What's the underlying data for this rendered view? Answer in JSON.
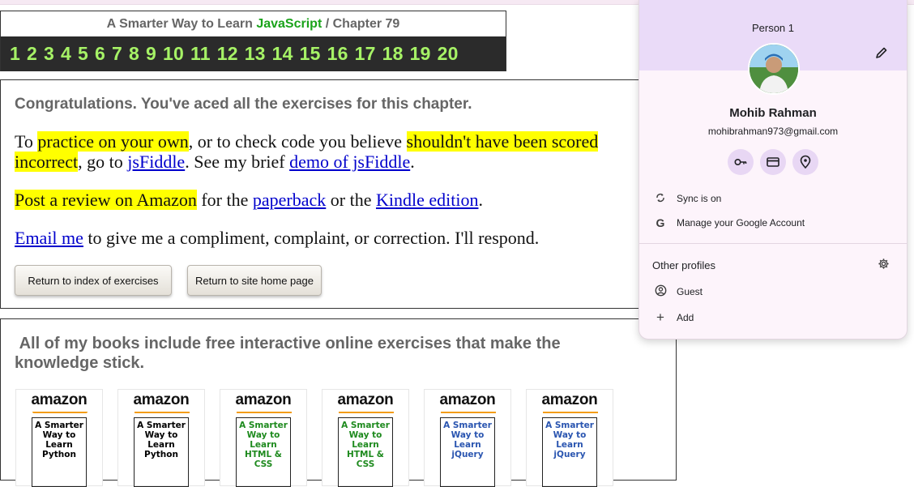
{
  "header": {
    "title_prefix": "A Smarter Way to Learn",
    "title_js": "JavaScript",
    "title_sep": "/",
    "title_chapter": "Chapter 79",
    "chapters": [
      "1",
      "2",
      "3",
      "4",
      "5",
      "6",
      "7",
      "8",
      "9",
      "10",
      "11",
      "12",
      "13",
      "14",
      "15",
      "16",
      "17",
      "18",
      "19",
      "20"
    ]
  },
  "main": {
    "congrats": "Congratulations. You've aced all the exercises for this chapter.",
    "p1_a": "To ",
    "p1_hl1": "practice on your own",
    "p1_b": ", or to check code you believe ",
    "p1_hl2": "shouldn't have been scored incorrect",
    "p1_c": ", go to ",
    "p1_link1": "jsFiddle",
    "p1_d": ". See my brief ",
    "p1_link2": "demo of jsFiddle",
    "p1_e": ".",
    "p2_hl": "Post a review on Amazon",
    "p2_a": " for the ",
    "p2_link1": "paperback",
    "p2_b": " or the ",
    "p2_link2": "Kindle edition",
    "p2_c": ".",
    "p3_link": "Email me",
    "p3_a": " to give me a compliment, complaint, or correction. I'll respond.",
    "btn_index": "Return to index of exercises",
    "btn_home": "Return to site home page"
  },
  "books": {
    "heading": "All of my books include free interactive online exercises that make the knowledge stick.",
    "amazon": "amazon",
    "items": [
      {
        "title": "A Smarter Way to Learn Python",
        "color": "#222222"
      },
      {
        "title": "A Smarter Way to Learn Python",
        "color": "#222222"
      },
      {
        "title": "A Smarter Way to Learn HTML & CSS",
        "color": "#1e8a1e"
      },
      {
        "title": "A Smarter Way to Learn HTML & CSS",
        "color": "#1e8a1e"
      },
      {
        "title": "A Smarter Way to Learn jQuery",
        "color": "#2a55b0"
      },
      {
        "title": "A Smarter Way to Learn jQuery",
        "color": "#2a55b0"
      }
    ]
  },
  "profile": {
    "label": "Person 1",
    "name": "Mohib Rahman",
    "email": "mohibrahman973@gmail.com",
    "sync": "Sync is on",
    "manage": "Manage your Google Account",
    "other_profiles": "Other profiles",
    "guest": "Guest",
    "add": "Add"
  }
}
